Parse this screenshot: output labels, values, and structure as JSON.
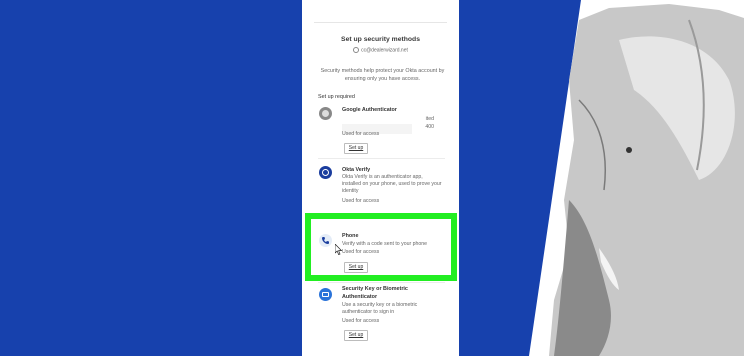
{
  "card": {
    "title": "Set up security methods",
    "email": "cc@dealerwizard.net",
    "description": "Security methods help protect your Okta account by ensuring only you have access.",
    "section_label": "Set up required"
  },
  "methods": [
    {
      "name": "Google Authenticator",
      "desc1": "ited",
      "desc2": "400",
      "used": "Used for access",
      "setup_label": "Set up",
      "icon": "google-authenticator-icon"
    },
    {
      "name": "Okta Verify",
      "desc": "Okta Verify is an authenticator app, installed on your phone, used to prove your identity",
      "used": "Used for access",
      "icon": "okta-verify-icon"
    },
    {
      "name": "Phone",
      "desc": "Verify with a code sent to your phone",
      "used": "Used for access",
      "setup_label": "Set up",
      "icon": "phone-icon"
    },
    {
      "name": "Security Key or Biometric Authenticator",
      "desc": "Use a security key or a biometric authenticator to sign in",
      "used": "Used for access",
      "setup_label": "Set up",
      "icon": "security-key-icon"
    }
  ],
  "colors": {
    "background_blue": "#1741ad",
    "highlight": "#22ee22"
  }
}
